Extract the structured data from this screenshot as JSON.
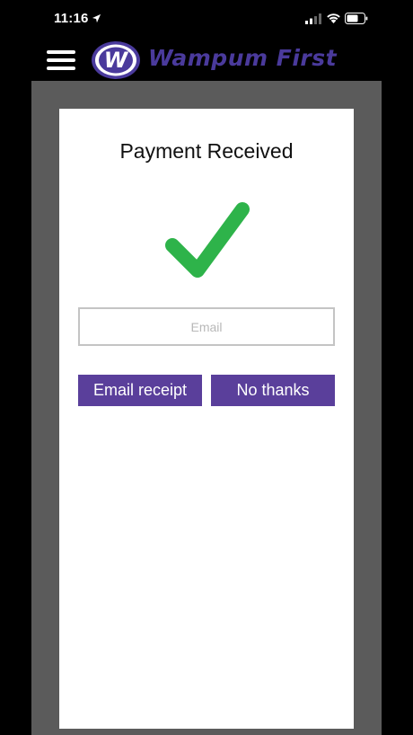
{
  "status_bar": {
    "time": "11:16",
    "icons": [
      "location-arrow-icon",
      "cellular-signal-icon",
      "wifi-icon",
      "battery-icon"
    ]
  },
  "header": {
    "brand_name": "Wampum First",
    "logo_letter": "W",
    "icons": [
      "hamburger-menu-icon",
      "wampum-logo-icon"
    ]
  },
  "receipt": {
    "title": "Payment Received",
    "success_icon": "checkmark-icon",
    "email_placeholder": "Email",
    "email_value": "",
    "email_receipt_label": "Email receipt",
    "no_thanks_label": "No thanks"
  },
  "colors": {
    "accent": "#5a3f9b",
    "brand": "#4a3a9c",
    "success": "#2eb34a",
    "frame": "#5b5b5b",
    "background": "#000000"
  }
}
